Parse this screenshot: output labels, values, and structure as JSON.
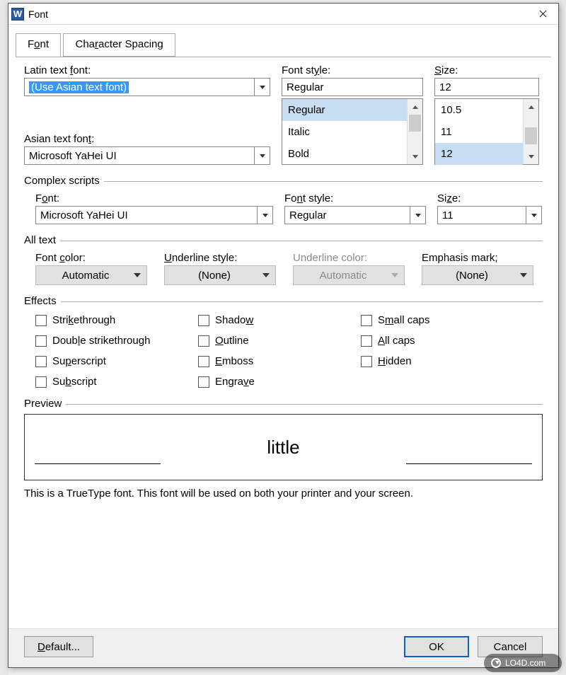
{
  "window": {
    "title": "Font",
    "app_icon_letter": "W"
  },
  "tabs": [
    {
      "label_pre": "F",
      "label_u": "o",
      "label_post": "nt"
    },
    {
      "label_pre": "Cha",
      "label_u": "r",
      "label_post": "acter Spacing"
    }
  ],
  "latin": {
    "label_pre": "Latin text ",
    "label_u": "f",
    "label_post": "ont:",
    "value": "(Use Asian text font)"
  },
  "asian": {
    "label_pre": "Asian text fon",
    "label_u": "t",
    "label_post": ":",
    "value": "Microsoft YaHei UI"
  },
  "font_style": {
    "label_pre": "Font st",
    "label_u": "y",
    "label_post": "le:",
    "value": "Regular",
    "options": [
      "Regular",
      "Italic",
      "Bold"
    ],
    "selected_index": 0
  },
  "size": {
    "label_pre": "",
    "label_u": "S",
    "label_post": "ize:",
    "value": "12",
    "options": [
      "10.5",
      "11",
      "12"
    ],
    "selected_index": 2
  },
  "complex": {
    "group": "Complex scripts",
    "font_label_pre": "F",
    "font_label_u": "o",
    "font_label_post": "nt:",
    "font_value": "Microsoft YaHei UI",
    "style_label_pre": "Fo",
    "style_label_u": "n",
    "style_label_post": "t style:",
    "style_value": "Regular",
    "size_label_pre": "Si",
    "size_label_u": "z",
    "size_label_post": "e:",
    "size_value": "11"
  },
  "alltext": {
    "group": "All text",
    "font_color_label_pre": "Font ",
    "font_color_label_u": "c",
    "font_color_label_post": "olor:",
    "font_color_value": "Automatic",
    "underline_style_label_pre": "",
    "underline_style_label_u": "U",
    "underline_style_label_post": "nderline style:",
    "underline_style_value": "(None)",
    "underline_color_label": "Underline color:",
    "underline_color_value": "Automatic",
    "emphasis_label_pre": "Emphasis mark",
    "emphasis_label_u": ";",
    "emphasis_label_post": "",
    "emphasis_value": "(None)"
  },
  "effects": {
    "group": "Effects",
    "col1": [
      {
        "pre": "Stri",
        "u": "k",
        "post": "ethrough"
      },
      {
        "pre": "Doub",
        "u": "l",
        "post": "e strikethrough"
      },
      {
        "pre": "Su",
        "u": "p",
        "post": "erscript"
      },
      {
        "pre": "Su",
        "u": "b",
        "post": "script"
      }
    ],
    "col2": [
      {
        "pre": "Shado",
        "u": "w",
        "post": ""
      },
      {
        "pre": "",
        "u": "O",
        "post": "utline"
      },
      {
        "pre": "",
        "u": "E",
        "post": "mboss"
      },
      {
        "pre": "Engra",
        "u": "v",
        "post": "e"
      }
    ],
    "col3": [
      {
        "pre": "S",
        "u": "m",
        "post": "all caps"
      },
      {
        "pre": "",
        "u": "A",
        "post": "ll caps"
      },
      {
        "pre": "",
        "u": "H",
        "post": "idden"
      }
    ]
  },
  "preview": {
    "group": "Preview",
    "sample": "little"
  },
  "description": "This is a TrueType font. This font will be used on both your printer and your screen.",
  "buttons": {
    "default_pre": "",
    "default_u": "D",
    "default_post": "efault...",
    "ok": "OK",
    "cancel": "Cancel"
  },
  "watermark": "LO4D.com"
}
